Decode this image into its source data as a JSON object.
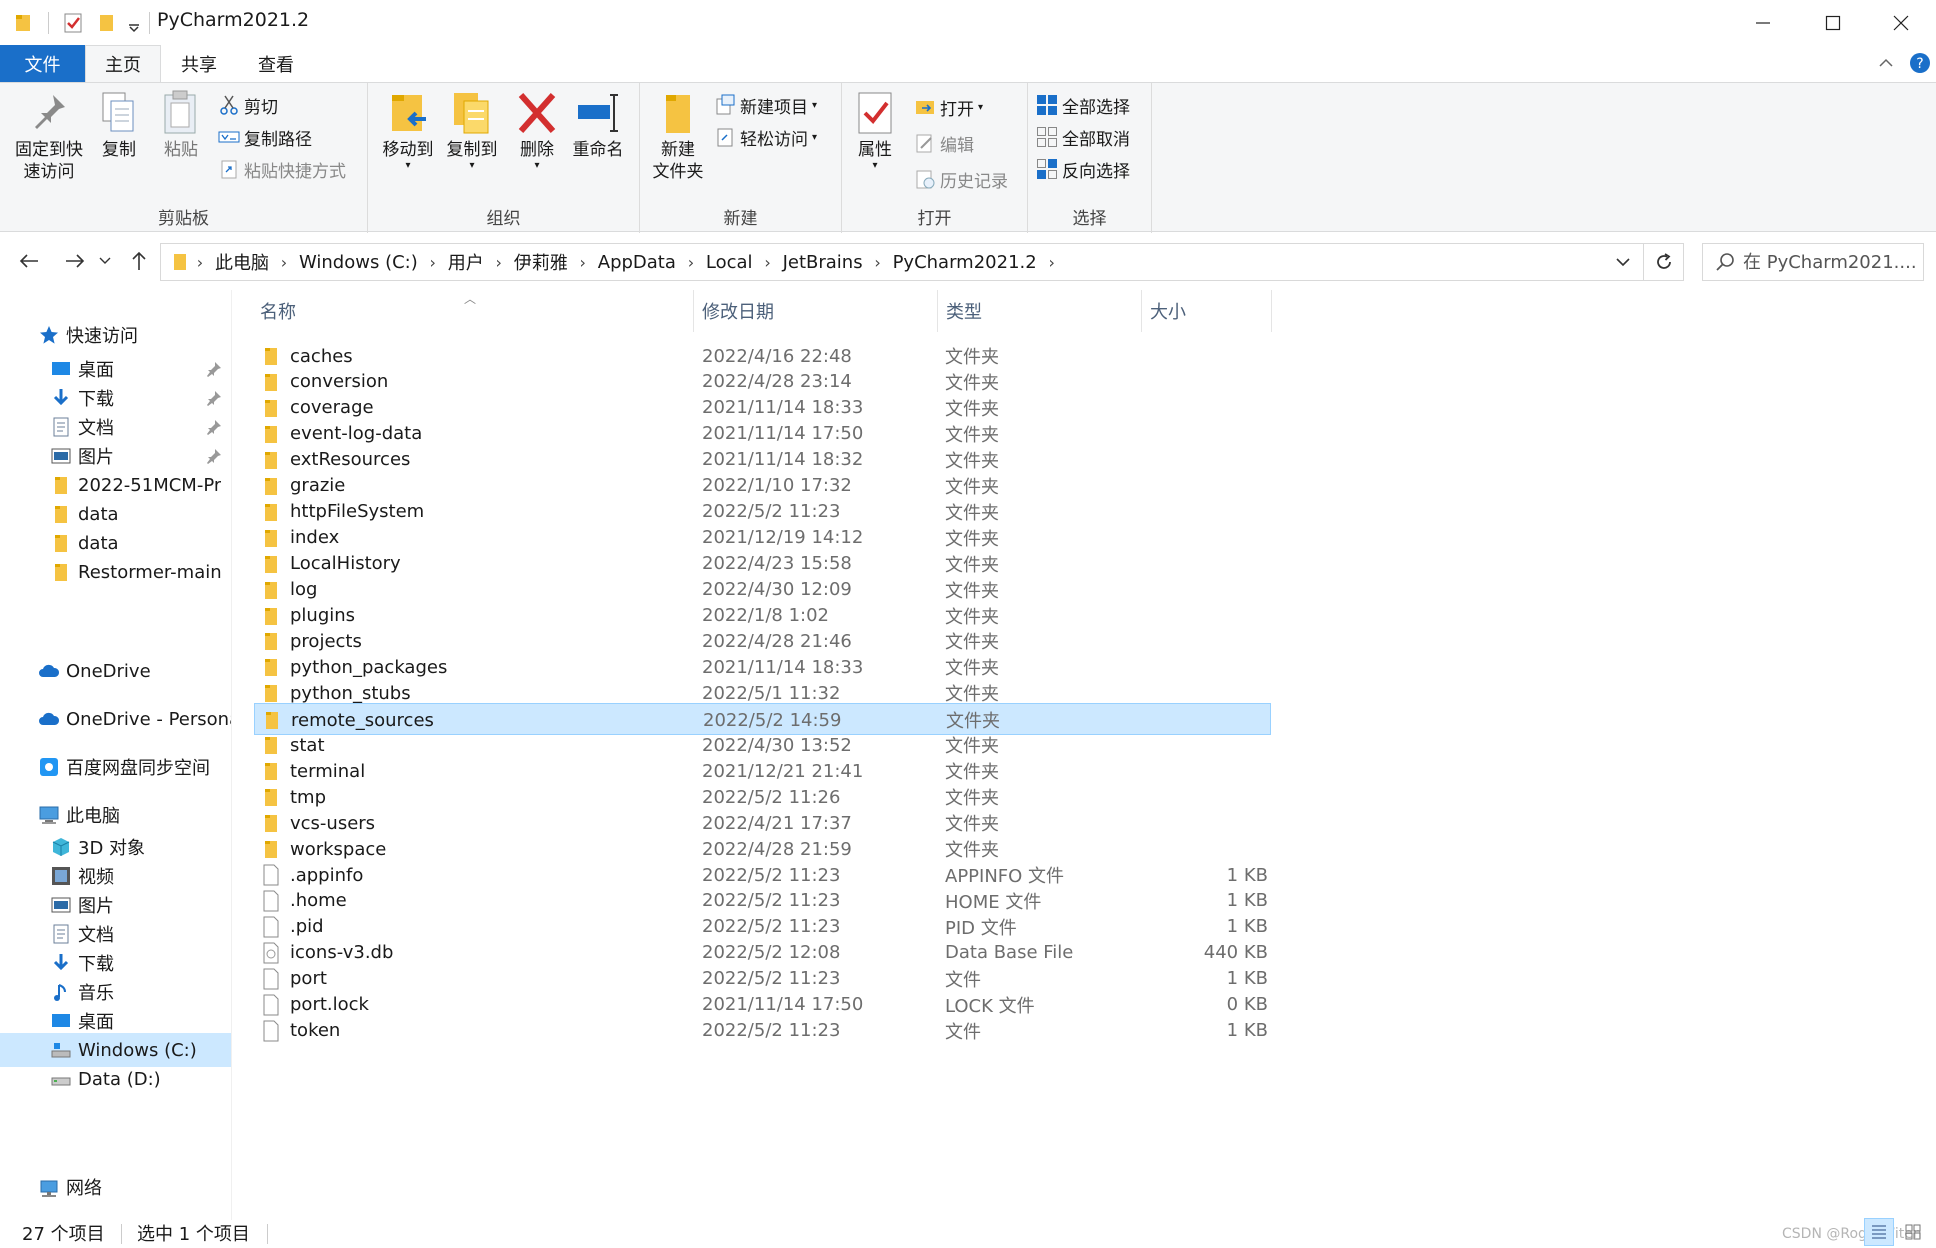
{
  "window": {
    "title": "PyCharm2021.2",
    "minimize": "—",
    "maximize": "☐",
    "close": "✕"
  },
  "ribbon_tabs": [
    "文件",
    "主页",
    "共享",
    "查看"
  ],
  "ribbon": {
    "clipboard": {
      "label": "剪贴板",
      "pin_line1": "固定到快",
      "pin_line2": "速访问",
      "copy": "复制",
      "paste": "粘贴",
      "cut": "剪切",
      "copy_path": "复制路径",
      "paste_shortcut": "粘贴快捷方式"
    },
    "organize": {
      "label": "组织",
      "move_to": "移动到",
      "copy_to": "复制到",
      "delete": "删除",
      "rename": "重命名"
    },
    "new": {
      "label": "新建",
      "new_folder_line1": "新建",
      "new_folder_line2": "文件夹",
      "new_item": "新建项目",
      "easy_access": "轻松访问"
    },
    "open": {
      "label": "打开",
      "properties": "属性",
      "open": "打开",
      "edit": "编辑",
      "history": "历史记录"
    },
    "select": {
      "label": "选择",
      "select_all": "全部选择",
      "select_none": "全部取消",
      "invert": "反向选择"
    }
  },
  "address": {
    "crumbs": [
      "此电脑",
      "Windows (C:)",
      "用户",
      "伊莉雅",
      "AppData",
      "Local",
      "JetBrains",
      "PyCharm2021.2"
    ],
    "search_placeholder": "在 PyCharm2021...."
  },
  "nav": {
    "quick_access": "快速访问",
    "items": [
      {
        "label": "桌面",
        "icon": "desktop-icon",
        "pinned": true
      },
      {
        "label": "下载",
        "icon": "download-icon",
        "pinned": true
      },
      {
        "label": "文档",
        "icon": "document-icon",
        "pinned": true
      },
      {
        "label": "图片",
        "icon": "picture-icon",
        "pinned": true
      },
      {
        "label": "2022-51MCM-Pr",
        "icon": "folder-icon",
        "pinned": false
      },
      {
        "label": "data",
        "icon": "folder-icon",
        "pinned": false
      },
      {
        "label": "data",
        "icon": "folder-icon",
        "pinned": false
      },
      {
        "label": "Restormer-main",
        "icon": "folder-icon",
        "pinned": false
      }
    ],
    "onedrive": "OneDrive",
    "onedrive_personal": "OneDrive - Persona",
    "baidu": "百度网盘同步空间",
    "this_pc": "此电脑",
    "pc_items": [
      {
        "label": "3D 对象",
        "icon": "cube-icon"
      },
      {
        "label": "视频",
        "icon": "video-icon"
      },
      {
        "label": "图片",
        "icon": "picture-icon"
      },
      {
        "label": "文档",
        "icon": "document-icon"
      },
      {
        "label": "下载",
        "icon": "download-icon"
      },
      {
        "label": "音乐",
        "icon": "music-icon"
      },
      {
        "label": "桌面",
        "icon": "desktop-icon"
      },
      {
        "label": "Windows (C:)",
        "icon": "drive-c-icon"
      },
      {
        "label": "Data (D:)",
        "icon": "drive-icon"
      }
    ],
    "network": "网络"
  },
  "columns": {
    "name": "名称",
    "date": "修改日期",
    "type": "类型",
    "size": "大小"
  },
  "files": [
    {
      "name": "caches",
      "date": "2022/4/16 22:48",
      "type": "文件夹",
      "size": "",
      "kind": "folder"
    },
    {
      "name": "conversion",
      "date": "2022/4/28 23:14",
      "type": "文件夹",
      "size": "",
      "kind": "folder"
    },
    {
      "name": "coverage",
      "date": "2021/11/14 18:33",
      "type": "文件夹",
      "size": "",
      "kind": "folder"
    },
    {
      "name": "event-log-data",
      "date": "2021/11/14 17:50",
      "type": "文件夹",
      "size": "",
      "kind": "folder"
    },
    {
      "name": "extResources",
      "date": "2021/11/14 18:32",
      "type": "文件夹",
      "size": "",
      "kind": "folder"
    },
    {
      "name": "grazie",
      "date": "2022/1/10 17:32",
      "type": "文件夹",
      "size": "",
      "kind": "folder"
    },
    {
      "name": "httpFileSystem",
      "date": "2022/5/2 11:23",
      "type": "文件夹",
      "size": "",
      "kind": "folder"
    },
    {
      "name": "index",
      "date": "2021/12/19 14:12",
      "type": "文件夹",
      "size": "",
      "kind": "folder"
    },
    {
      "name": "LocalHistory",
      "date": "2022/4/23 15:58",
      "type": "文件夹",
      "size": "",
      "kind": "folder"
    },
    {
      "name": "log",
      "date": "2022/4/30 12:09",
      "type": "文件夹",
      "size": "",
      "kind": "folder"
    },
    {
      "name": "plugins",
      "date": "2022/1/8 1:02",
      "type": "文件夹",
      "size": "",
      "kind": "folder"
    },
    {
      "name": "projects",
      "date": "2022/4/28 21:46",
      "type": "文件夹",
      "size": "",
      "kind": "folder"
    },
    {
      "name": "python_packages",
      "date": "2021/11/14 18:33",
      "type": "文件夹",
      "size": "",
      "kind": "folder"
    },
    {
      "name": "python_stubs",
      "date": "2022/5/1 11:32",
      "type": "文件夹",
      "size": "",
      "kind": "folder"
    },
    {
      "name": "remote_sources",
      "date": "2022/5/2 14:59",
      "type": "文件夹",
      "size": "",
      "kind": "folder",
      "selected": true
    },
    {
      "name": "stat",
      "date": "2022/4/30 13:52",
      "type": "文件夹",
      "size": "",
      "kind": "folder"
    },
    {
      "name": "terminal",
      "date": "2021/12/21 21:41",
      "type": "文件夹",
      "size": "",
      "kind": "folder"
    },
    {
      "name": "tmp",
      "date": "2022/5/2 11:26",
      "type": "文件夹",
      "size": "",
      "kind": "folder"
    },
    {
      "name": "vcs-users",
      "date": "2022/4/21 17:37",
      "type": "文件夹",
      "size": "",
      "kind": "folder"
    },
    {
      "name": "workspace",
      "date": "2022/4/28 21:59",
      "type": "文件夹",
      "size": "",
      "kind": "folder"
    },
    {
      "name": ".appinfo",
      "date": "2022/5/2 11:23",
      "type": "APPINFO 文件",
      "size": "1 KB",
      "kind": "file"
    },
    {
      "name": ".home",
      "date": "2022/5/2 11:23",
      "type": "HOME 文件",
      "size": "1 KB",
      "kind": "file"
    },
    {
      "name": ".pid",
      "date": "2022/5/2 11:23",
      "type": "PID 文件",
      "size": "1 KB",
      "kind": "file"
    },
    {
      "name": "icons-v3.db",
      "date": "2022/5/2 12:08",
      "type": "Data Base File",
      "size": "440 KB",
      "kind": "db"
    },
    {
      "name": "port",
      "date": "2022/5/2 11:23",
      "type": "文件",
      "size": "1 KB",
      "kind": "file"
    },
    {
      "name": "port.lock",
      "date": "2021/11/14 17:50",
      "type": "LOCK 文件",
      "size": "0 KB",
      "kind": "file"
    },
    {
      "name": "token",
      "date": "2022/5/2 11:23",
      "type": "文件",
      "size": "1 KB",
      "kind": "file"
    }
  ],
  "status": {
    "count": "27 个项目",
    "selected": "选中 1 个项目"
  },
  "watermark": "CSDN @RogerWiten",
  "colors": {
    "accent": "#1a6fc9",
    "selection": "#cce8ff",
    "folder": "#f5c342"
  }
}
